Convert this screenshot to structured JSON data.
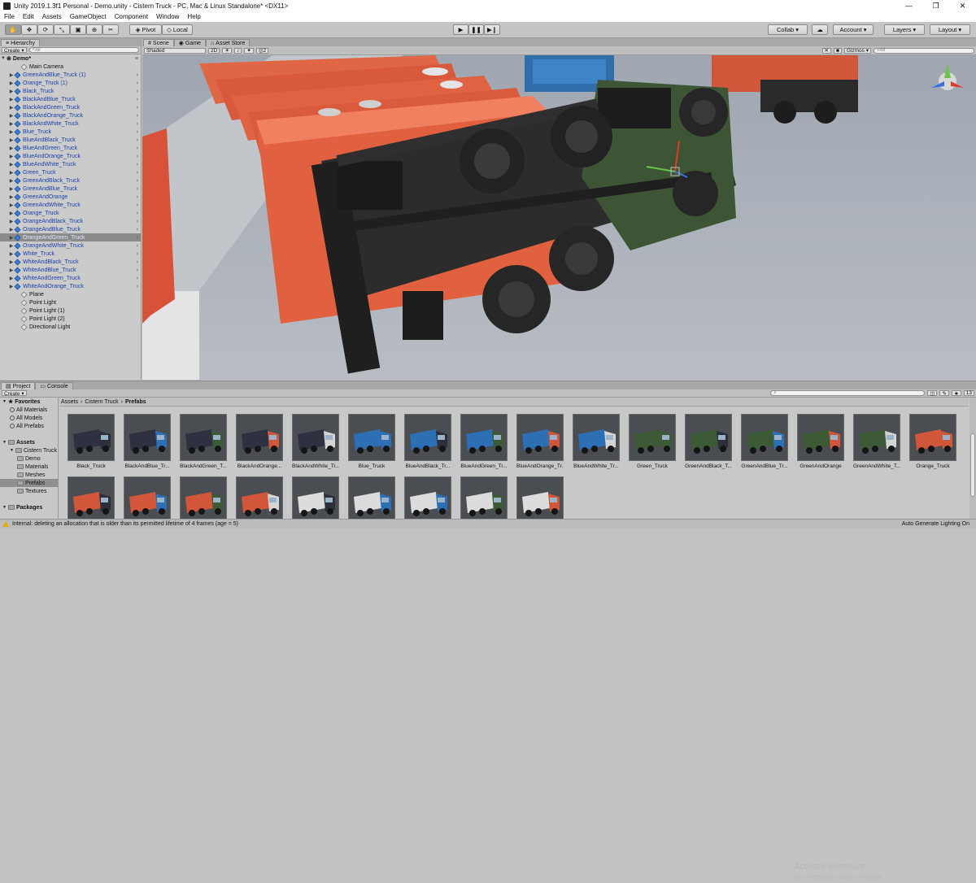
{
  "window": {
    "title": "Unity 2019.1.3f1 Personal - Demo.unity - Cistern Truck - PC, Mac & Linux Standalone* <DX11>",
    "minimize": "—",
    "maximize": "❐",
    "close": "✕"
  },
  "menu": [
    "File",
    "Edit",
    "Assets",
    "GameObject",
    "Component",
    "Window",
    "Help"
  ],
  "toolbar": {
    "pivot": "Pivot",
    "local": "Local",
    "collab": "Collab ▾",
    "account": "Account ▾",
    "layers": "Layers ▾",
    "layout": "Layout ▾",
    "play": "▶",
    "pause": "❚❚",
    "step": "▶❙"
  },
  "hierarchy": {
    "tab": "Hierarchy",
    "create": "Create ▾",
    "search": "All",
    "scene": "Demo*",
    "items": [
      {
        "name": "Main Camera",
        "type": "go"
      },
      {
        "name": "GreenAndBlue_Truck (1)",
        "type": "prefab"
      },
      {
        "name": "Orange_Truck (1)",
        "type": "prefab"
      },
      {
        "name": "Black_Truck",
        "type": "prefab"
      },
      {
        "name": "BlackAndBlue_Truck",
        "type": "prefab"
      },
      {
        "name": "BlackAndGreen_Truck",
        "type": "prefab"
      },
      {
        "name": "BlackAndOrange_Truck",
        "type": "prefab"
      },
      {
        "name": "BlackAndWhite_Truck",
        "type": "prefab"
      },
      {
        "name": "Blue_Truck",
        "type": "prefab"
      },
      {
        "name": "BlueAndBlack_Truck",
        "type": "prefab"
      },
      {
        "name": "BlueAndGreen_Truck",
        "type": "prefab"
      },
      {
        "name": "BlueAndOrange_Truck",
        "type": "prefab"
      },
      {
        "name": "BlueAndWhite_Truck",
        "type": "prefab"
      },
      {
        "name": "Green_Truck",
        "type": "prefab"
      },
      {
        "name": "GreenAndBlack_Truck",
        "type": "prefab"
      },
      {
        "name": "GreenAndBlue_Truck",
        "type": "prefab"
      },
      {
        "name": "GreenAndOrange",
        "type": "prefab"
      },
      {
        "name": "GreenAndWhite_Truck",
        "type": "prefab"
      },
      {
        "name": "Orange_Truck",
        "type": "prefab"
      },
      {
        "name": "OrangeAndBlack_Truck",
        "type": "prefab"
      },
      {
        "name": "OrangeAndBlue_Truck",
        "type": "prefab"
      },
      {
        "name": "OrangeAndGreen_Truck",
        "type": "prefab",
        "selected": true
      },
      {
        "name": "OrangeAndWhite_Truck",
        "type": "prefab"
      },
      {
        "name": "White_Truck",
        "type": "prefab"
      },
      {
        "name": "WhiteAndBlack_Truck",
        "type": "prefab"
      },
      {
        "name": "WhiteAndBlue_Truck",
        "type": "prefab"
      },
      {
        "name": "WhiteAndGreen_Truck",
        "type": "prefab"
      },
      {
        "name": "WhiteAndOrange_Truck",
        "type": "prefab"
      },
      {
        "name": "Plane",
        "type": "go"
      },
      {
        "name": "Point Light",
        "type": "go"
      },
      {
        "name": "Point Light (1)",
        "type": "go"
      },
      {
        "name": "Point Light (2)",
        "type": "go"
      },
      {
        "name": "Directional Light",
        "type": "go"
      }
    ]
  },
  "scene_tabs": [
    {
      "label": "Scene",
      "active": true
    },
    {
      "label": "Game"
    },
    {
      "label": "Asset Store"
    }
  ],
  "scene_bar": {
    "shading": "Shaded",
    "mode2d": "2D",
    "gizmos": "Gizmos ▾",
    "search": "All",
    "layer_count": "2"
  },
  "project": {
    "tabs": [
      "Project",
      "Console"
    ],
    "create": "Create ▾",
    "count": "13",
    "tree": [
      {
        "label": "Favorites",
        "level": 0,
        "bold": true
      },
      {
        "label": "All Materials",
        "level": 1,
        "search": true
      },
      {
        "label": "All Models",
        "level": 1,
        "search": true
      },
      {
        "label": "All Prefabs",
        "level": 1,
        "search": true
      },
      {
        "label": "",
        "level": 0
      },
      {
        "label": "Assets",
        "level": 0,
        "bold": true
      },
      {
        "label": "Cistern Truck",
        "level": 1
      },
      {
        "label": "Demo",
        "level": 2
      },
      {
        "label": "Materials",
        "level": 2
      },
      {
        "label": "Meshes",
        "level": 2
      },
      {
        "label": "Prefabs",
        "level": 2,
        "selected": true
      },
      {
        "label": "Textures",
        "level": 2
      },
      {
        "label": "",
        "level": 0
      },
      {
        "label": "Packages",
        "level": 0,
        "bold": true
      }
    ],
    "breadcrumb": [
      "Assets",
      "Cistern Truck",
      "Prefabs"
    ],
    "assets": [
      {
        "label": "Black_Truck",
        "cab": "#2c2f3a",
        "tank": "#2e3140"
      },
      {
        "label": "BlackAndBlue_Tr...",
        "cab": "#2d6fb5",
        "tank": "#2e3140"
      },
      {
        "label": "BlackAndGreen_T...",
        "cab": "#3d5a36",
        "tank": "#2e3140"
      },
      {
        "label": "BlackAndOrange...",
        "cab": "#d2573a",
        "tank": "#2e3140"
      },
      {
        "label": "BlackAndWhite_Tr...",
        "cab": "#d5d5d5",
        "tank": "#2e3140"
      },
      {
        "label": "Blue_Truck",
        "cab": "#2d6fb5",
        "tank": "#2d6fb5"
      },
      {
        "label": "BlueAndBlack_Tr...",
        "cab": "#2c2f3a",
        "tank": "#2d6fb5"
      },
      {
        "label": "BlueAndGreen_Tr...",
        "cab": "#3d5a36",
        "tank": "#2d6fb5"
      },
      {
        "label": "BlueAndOrange_Tr...",
        "cab": "#d2573a",
        "tank": "#2d6fb5"
      },
      {
        "label": "BlueAndWhite_Tr...",
        "cab": "#d5d5d5",
        "tank": "#2d6fb5"
      },
      {
        "label": "Green_Truck",
        "cab": "#3d5a36",
        "tank": "#3d5a36"
      },
      {
        "label": "GreenAndBlack_T...",
        "cab": "#2c2f3a",
        "tank": "#3d5a36"
      },
      {
        "label": "GreenAndBlue_Tr...",
        "cab": "#2d6fb5",
        "tank": "#3d5a36"
      },
      {
        "label": "GreenAndOrange",
        "cab": "#d2573a",
        "tank": "#3d5a36"
      },
      {
        "label": "GreenAndWhite_T...",
        "cab": "#d5d5d5",
        "tank": "#3d5a36"
      },
      {
        "label": "Orange_Truck",
        "cab": "#d2573a",
        "tank": "#d2573a"
      },
      {
        "label": "",
        "cab": "#2c2f3a",
        "tank": "#d2573a"
      },
      {
        "label": "",
        "cab": "#2d6fb5",
        "tank": "#d2573a"
      },
      {
        "label": "",
        "cab": "#3d5a36",
        "tank": "#d2573a"
      },
      {
        "label": "",
        "cab": "#d5d5d5",
        "tank": "#d2573a"
      },
      {
        "label": "",
        "cab": "#2c2f3a",
        "tank": "#dcdcdc"
      },
      {
        "label": "",
        "cab": "#2d6fb5",
        "tank": "#dcdcdc"
      },
      {
        "label": "",
        "cab": "#2d6fb5",
        "tank": "#dcdcdc"
      },
      {
        "label": "",
        "cab": "#3d5a36",
        "tank": "#dcdcdc"
      },
      {
        "label": "",
        "cab": "#d2573a",
        "tank": "#dcdcdc"
      }
    ]
  },
  "watermark": {
    "title": "Activate Windows",
    "sub": "Go to Settings to activate Windows."
  },
  "status": {
    "message": "Internal: deleting an allocation that is older than its permitted lifetime of 4 frames (age = 5)",
    "right": "Auto Generate Lighting On"
  },
  "colors": {
    "orange": "#d2573a",
    "accent": "#3d7fd6"
  }
}
